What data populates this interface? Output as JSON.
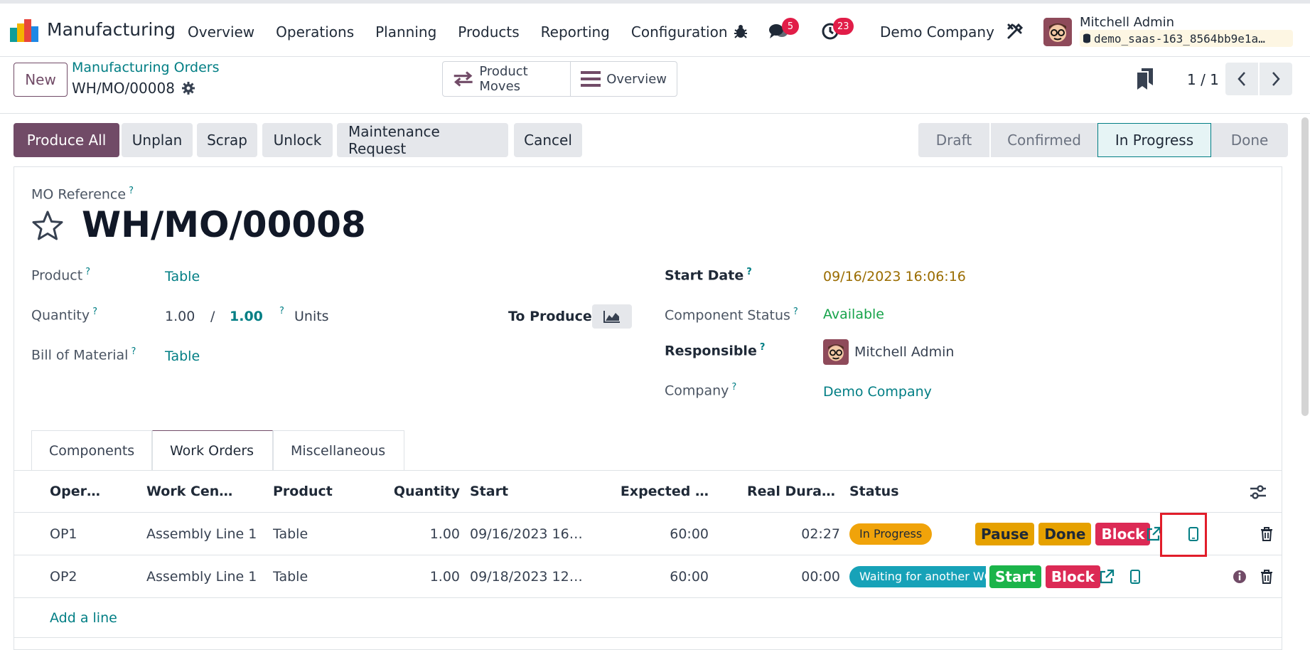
{
  "topbar": {
    "app_name": "Manufacturing",
    "menu": [
      "Overview",
      "Operations",
      "Planning",
      "Products",
      "Reporting",
      "Configuration"
    ],
    "messages_count": "5",
    "activities_count": "23",
    "company": "Demo Company",
    "user_name": "Mitchell Admin",
    "database": "demo_saas-163_8564bb9e1a…"
  },
  "control": {
    "new_label": "New",
    "breadcrumb_parent": "Manufacturing Orders",
    "breadcrumb_current": "WH/MO/00008",
    "smart_buttons": [
      "Product Moves",
      "Overview"
    ],
    "pager": "1 / 1"
  },
  "actions": {
    "produce_all": "Produce All",
    "unplan": "Unplan",
    "scrap": "Scrap",
    "unlock": "Unlock",
    "maintenance": "Maintenance Request",
    "cancel": "Cancel"
  },
  "status_stages": [
    "Draft",
    "Confirmed",
    "In Progress",
    "Done"
  ],
  "status_active": "In Progress",
  "form": {
    "mo_reference_label": "MO Reference",
    "mo_reference": "WH/MO/00008",
    "product_label": "Product",
    "product": "Table",
    "quantity_label": "Quantity",
    "quantity_produced": "1.00",
    "quantity_sep": "/",
    "quantity_total": "1.00",
    "quantity_uom": "Units",
    "to_produce_label": "To Produce",
    "bom_label": "Bill of Material",
    "bom": "Table",
    "start_date_label": "Start Date",
    "start_date": "09/16/2023 16:06:16",
    "component_status_label": "Component Status",
    "component_status": "Available",
    "responsible_label": "Responsible",
    "responsible": "Mitchell Admin",
    "company_label": "Company",
    "company": "Demo Company"
  },
  "tabs": [
    "Components",
    "Work Orders",
    "Miscellaneous"
  ],
  "active_tab": "Work Orders",
  "work_orders": {
    "columns": [
      "Oper…",
      "Work Cen…",
      "Product",
      "Quantity",
      "Start",
      "Expected …",
      "Real Dura…",
      "Status"
    ],
    "rows": [
      {
        "operation": "OP1",
        "work_center": "Assembly Line 1",
        "product": "Table",
        "quantity": "1.00",
        "start": "09/16/2023 16…",
        "expected": "60:00",
        "real": "02:27",
        "status": "In Progress",
        "buttons": [
          "Pause",
          "Done",
          "Block"
        ]
      },
      {
        "operation": "OP2",
        "work_center": "Assembly Line 1",
        "product": "Table",
        "quantity": "1.00",
        "start": "09/18/2023 12…",
        "expected": "60:00",
        "real": "00:00",
        "status": "Waiting for another WO",
        "buttons": [
          "Start",
          "Block"
        ]
      }
    ],
    "add_line": "Add a line"
  },
  "colors": {
    "brand": "#714B67",
    "link": "#017e84",
    "in_progress": "#f0a30a",
    "waiting": "#17a2b8",
    "done_btn": "#e6a100",
    "block_btn": "#dc2a55",
    "start_btn": "#1bb44a",
    "highlight": "#e11d2a"
  }
}
